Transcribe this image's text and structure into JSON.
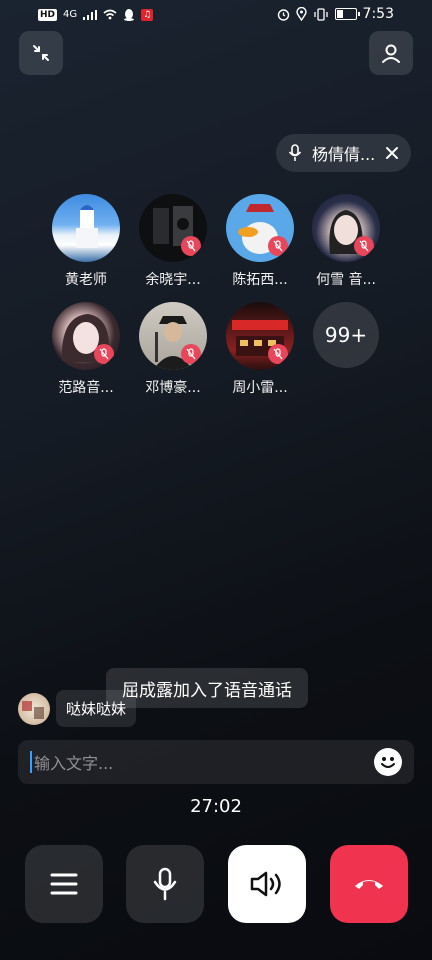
{
  "status_bar": {
    "hd": "HD",
    "signal": "4G",
    "time": "7:53"
  },
  "top": {
    "minimize_icon": "collapse-arrows-icon",
    "profile_icon": "person-icon",
    "speaker_pill": {
      "name": "杨倩倩...",
      "mic_icon": "mic-icon",
      "close_icon": "close-icon"
    }
  },
  "members": [
    {
      "name": "黄老师",
      "muted": false
    },
    {
      "name": "余晓宇...",
      "muted": true
    },
    {
      "name": "陈拓西...",
      "muted": true
    },
    {
      "name": "何雪 音...",
      "muted": true
    },
    {
      "name": "范路音...",
      "muted": true
    },
    {
      "name": "邓博豪...",
      "muted": true
    },
    {
      "name": "周小雷...",
      "muted": true
    }
  ],
  "more_count": "99+",
  "toast": "屈成露加入了语音通话",
  "chat": {
    "message": "哒妹哒妹"
  },
  "input": {
    "placeholder": "输入文字..."
  },
  "call_timer": "27:02",
  "controls": {
    "menu_icon": "menu-icon",
    "mic_icon": "mic-icon",
    "speaker_icon": "speaker-icon",
    "hangup_icon": "hangup-icon",
    "hangup_color": "#f0344f"
  }
}
